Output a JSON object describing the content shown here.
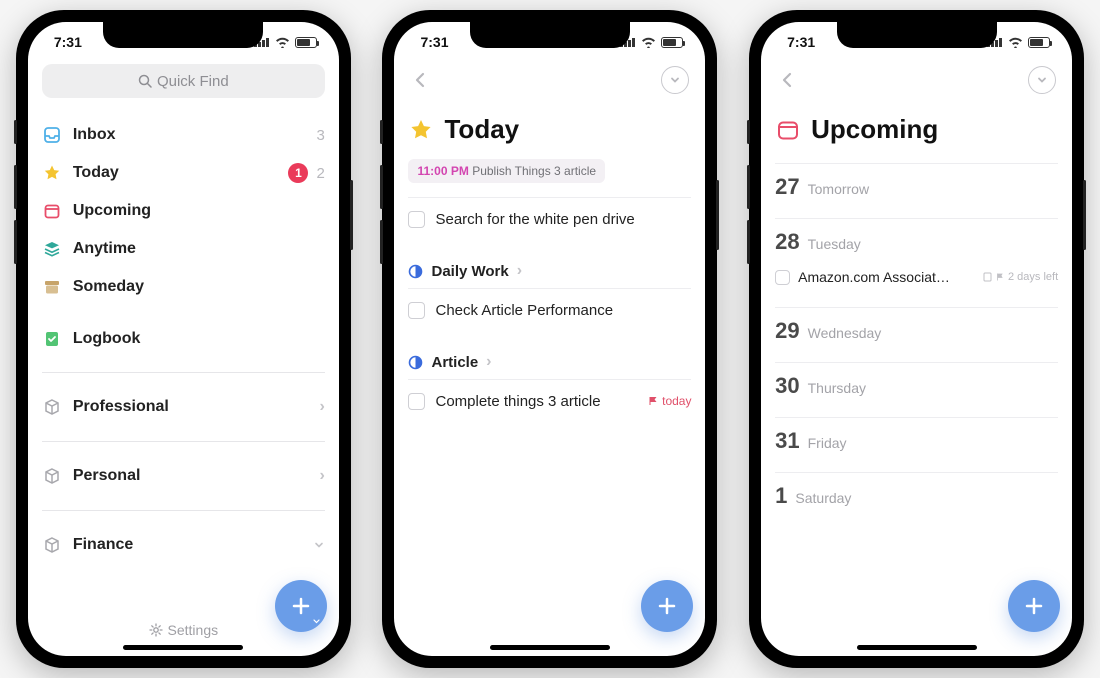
{
  "status": {
    "time": "7:31"
  },
  "screen1": {
    "search_placeholder": "Quick Find",
    "rows": {
      "inbox": {
        "label": "Inbox",
        "count": "3"
      },
      "today": {
        "label": "Today",
        "badge": "1",
        "count": "2"
      },
      "upcoming": {
        "label": "Upcoming"
      },
      "anytime": {
        "label": "Anytime"
      },
      "someday": {
        "label": "Someday"
      },
      "logbook": {
        "label": "Logbook"
      }
    },
    "areas": {
      "professional": {
        "label": "Professional"
      },
      "personal": {
        "label": "Personal"
      },
      "finance": {
        "label": "Finance"
      }
    },
    "settings_label": "Settings"
  },
  "screen2": {
    "title": "Today",
    "schedule": {
      "time": "11:00 PM",
      "text": "Publish Things 3 article"
    },
    "task_standalone": "Search for the white pen drive",
    "proj_daily": {
      "name": "Daily Work",
      "task": "Check Article Performance"
    },
    "proj_article": {
      "name": "Article",
      "task": "Complete things 3 article",
      "flag": "today"
    }
  },
  "screen3": {
    "title": "Upcoming",
    "days": {
      "d27": {
        "num": "27",
        "name": "Tomorrow"
      },
      "d28": {
        "num": "28",
        "name": "Tuesday",
        "task": "Amazon.com Associat…",
        "meta": "2 days left"
      },
      "d29": {
        "num": "29",
        "name": "Wednesday"
      },
      "d30": {
        "num": "30",
        "name": "Thursday"
      },
      "d31": {
        "num": "31",
        "name": "Friday"
      },
      "d1": {
        "num": "1",
        "name": "Saturday"
      }
    }
  }
}
